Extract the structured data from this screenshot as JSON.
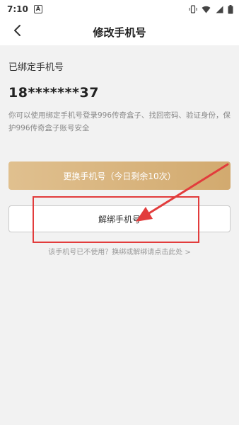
{
  "status_bar": {
    "time": "7:10",
    "app_icon_letter": "A",
    "icons": [
      "vibrate-icon",
      "wifi-icon",
      "signal-icon",
      "battery-icon"
    ]
  },
  "nav": {
    "back_icon": "chevron-left-icon",
    "title": "修改手机号"
  },
  "bound_section": {
    "label": "已绑定手机号",
    "phone": "18*******37",
    "description": "你可以使用绑定手机号登录996传奇盒子、找回密码、验证身份，保护996传奇盒子账号安全"
  },
  "buttons": {
    "change_label": "更换手机号（今日剩余10次）",
    "unbind_label": "解绑手机号"
  },
  "help_link": "该手机号已不使用？换绑或解绑请点击此处 >",
  "colors": {
    "accent_gold": "#d6b27a",
    "annotation_red": "#e23c3c",
    "background": "#f2f2f2"
  }
}
